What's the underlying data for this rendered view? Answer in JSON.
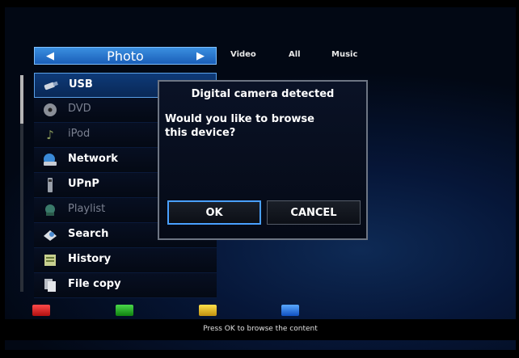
{
  "category_bar": {
    "current": "Photo",
    "left_arrow": "◀",
    "right_arrow": "▶",
    "tabs": [
      "Video",
      "All",
      "Music"
    ]
  },
  "menu": {
    "items": [
      {
        "label": "USB",
        "icon": "usb-icon",
        "enabled": true,
        "selected": true
      },
      {
        "label": "DVD",
        "icon": "disc-icon",
        "enabled": false
      },
      {
        "label": "iPod",
        "icon": "music-note-icon",
        "enabled": false
      },
      {
        "label": "Network",
        "icon": "network-icon",
        "enabled": true
      },
      {
        "label": "UPnP",
        "icon": "upnp-icon",
        "enabled": true
      },
      {
        "label": "Playlist",
        "icon": "playlist-icon",
        "enabled": false
      },
      {
        "label": "Search",
        "icon": "search-icon",
        "enabled": true
      },
      {
        "label": "History",
        "icon": "history-icon",
        "enabled": true
      },
      {
        "label": "File copy",
        "icon": "file-copy-icon",
        "enabled": true
      }
    ]
  },
  "dialog": {
    "title": "Digital camera detected",
    "message": "Would you like to browse this device?",
    "ok_label": "OK",
    "cancel_label": "CANCEL"
  },
  "color_keys": {
    "red": "#d81818",
    "green": "#1aa81a",
    "yellow": "#e8c010",
    "blue": "#2a78e0"
  },
  "status_text": "Press OK to browse the content"
}
